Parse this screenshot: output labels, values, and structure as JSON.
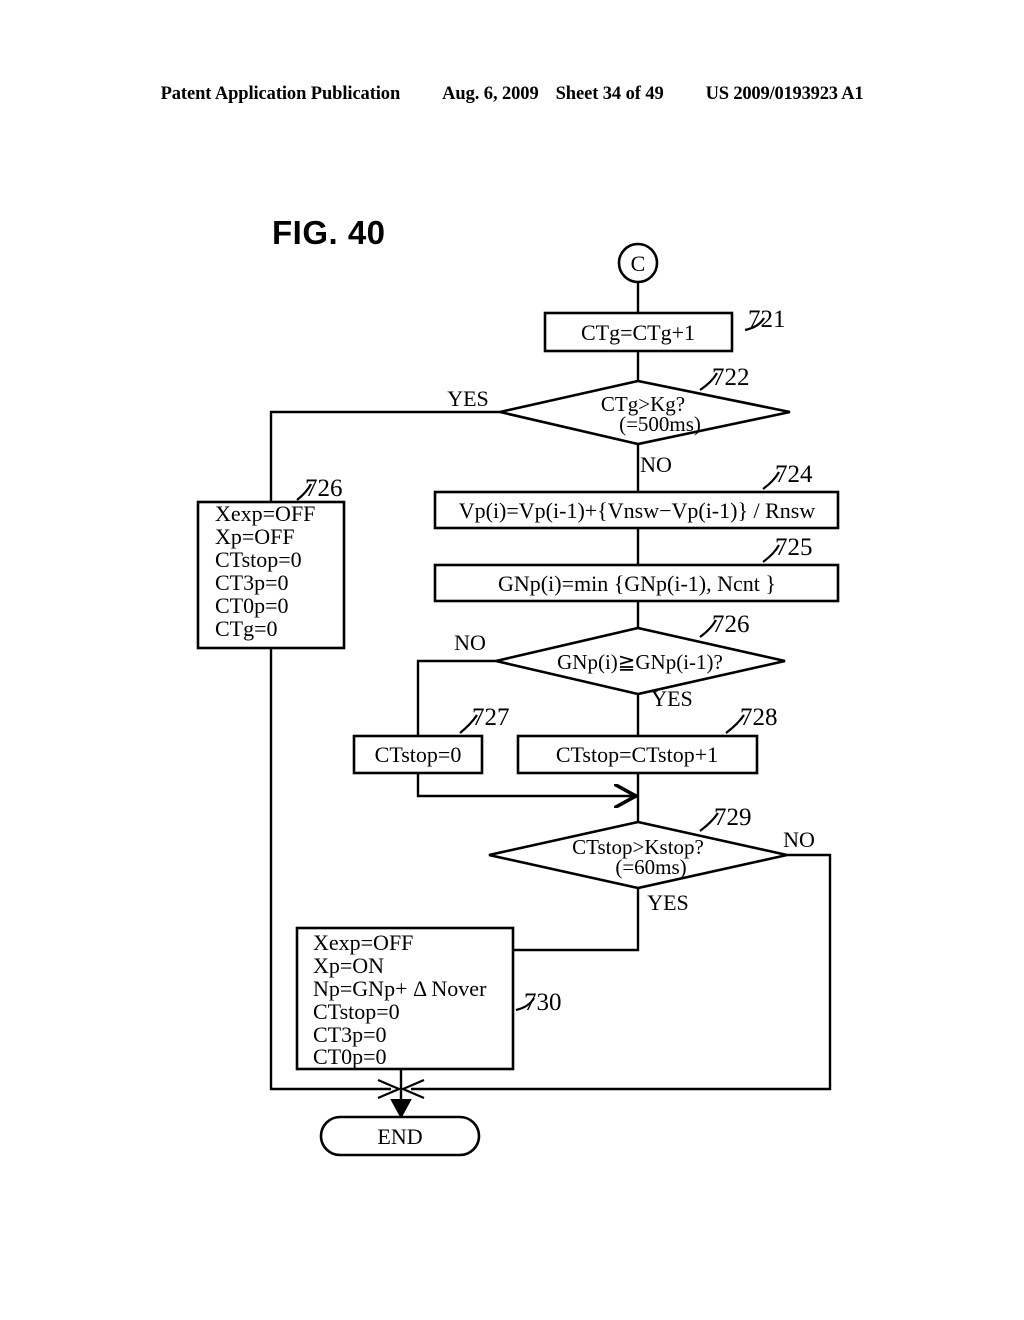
{
  "header": {
    "publication": "Patent Application Publication",
    "date": "Aug. 6, 2009",
    "sheet": "Sheet 34 of 49",
    "patent_number": "US 2009/0193923 A1"
  },
  "figure": {
    "title": "FIG. 40"
  },
  "flowchart": {
    "connector_in": {
      "label": "C",
      "name": "connector-c"
    },
    "nodes": [
      {
        "id": "721",
        "type": "process",
        "ref": "721",
        "lines": [
          "CTg=CTg+1"
        ]
      },
      {
        "id": "722",
        "type": "decision",
        "ref": "722",
        "lines": [
          "CTg>Kg?",
          "(=500ms)"
        ],
        "yes_label": "YES",
        "no_label": "NO"
      },
      {
        "id": "724",
        "type": "process",
        "ref": "724",
        "lines": [
          "Vp(i)=Vp(i-1)+{Vnsw−Vp(i-1)} / Rnsw"
        ]
      },
      {
        "id": "725",
        "type": "process",
        "ref": "725",
        "lines": [
          "GNp(i)=min {GNp(i-1), Ncnt }"
        ]
      },
      {
        "id": "726L",
        "type": "process",
        "ref": "726",
        "lines": [
          "Xexp=OFF",
          "Xp=OFF",
          "CTstop=0",
          "CT3p=0",
          "CT0p=0",
          "CTg=0"
        ]
      },
      {
        "id": "726D",
        "type": "decision",
        "ref": "726",
        "lines": [
          "GNp(i)≧GNp(i-1)?"
        ],
        "yes_label": "YES",
        "no_label": "NO"
      },
      {
        "id": "727",
        "type": "process",
        "ref": "727",
        "lines": [
          "CTstop=0"
        ]
      },
      {
        "id": "728",
        "type": "process",
        "ref": "728",
        "lines": [
          "CTstop=CTstop+1"
        ]
      },
      {
        "id": "729",
        "type": "decision",
        "ref": "729",
        "lines": [
          "CTstop>Kstop?",
          "(=60ms)"
        ],
        "yes_label": "YES",
        "no_label": "NO"
      },
      {
        "id": "730",
        "type": "process",
        "ref": "730",
        "lines": [
          "Xexp=OFF",
          "Xp=ON",
          "Np=GNp+ Δ Nover",
          "CTstop=0",
          "CT3p=0",
          "CT0p=0"
        ]
      },
      {
        "id": "end",
        "type": "terminator",
        "ref": "",
        "lines": [
          "END"
        ]
      }
    ],
    "labels": {
      "yes_722": "YES",
      "no_722": "NO",
      "no_726": "NO",
      "yes_726": "YES",
      "no_729": "NO",
      "yes_729": "YES"
    },
    "refs": {
      "r721": "721",
      "r722": "722",
      "r724": "724",
      "r725": "725",
      "r726left": "726",
      "r726diamond": "726",
      "r727": "727",
      "r728": "728",
      "r729": "729",
      "r730": "730"
    },
    "texts": {
      "t721": "CTg=CTg+1",
      "t722a": "CTg>Kg?",
      "t722b": "(=500ms)",
      "t724": "Vp(i)=Vp(i-1)+{Vnsw−Vp(i-1)} / Rnsw",
      "t725": "GNp(i)=min {GNp(i-1), Ncnt }",
      "t726a": "Xexp=OFF",
      "t726b": "Xp=OFF",
      "t726c": "CTstop=0",
      "t726d": "CT3p=0",
      "t726e": "CT0p=0",
      "t726f": "CTg=0",
      "t726d1": "GNp(i)≧GNp(i-1)?",
      "t727": "CTstop=0",
      "t728": "CTstop=CTstop+1",
      "t729a": "CTstop>Kstop?",
      "t729b": "(=60ms)",
      "t730a": "Xexp=OFF",
      "t730b": "Xp=ON",
      "t730c": "Np=GNp+ Δ Nover",
      "t730d": "CTstop=0",
      "t730e": "CT3p=0",
      "t730f": "CT0p=0",
      "tend": "END",
      "tconnector": "C"
    }
  },
  "colors": {
    "ink": "#000000",
    "paper": "#ffffff"
  }
}
